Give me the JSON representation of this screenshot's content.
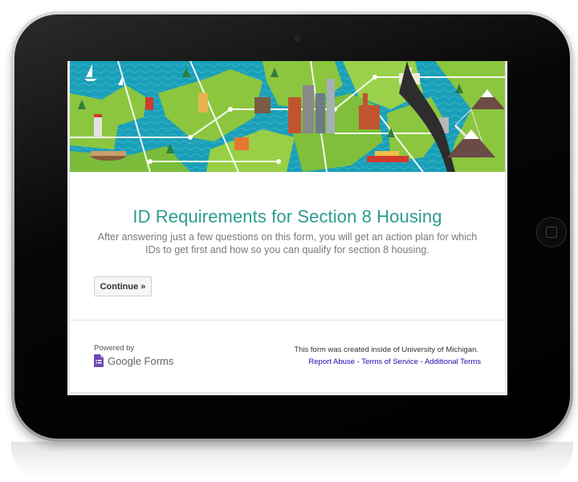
{
  "form": {
    "title": "ID Requirements for Section 8 Housing",
    "description": "After answering just a few questions on this form, you will get an action plan for which IDs to get first and how so you can qualify for section 8 housing.",
    "continue_label": "Continue »"
  },
  "footer": {
    "powered_by": "Powered by",
    "brand": "Google Forms",
    "created_inside": "This form was created inside of University of Michigan.",
    "links": {
      "report_abuse": "Report Abuse",
      "terms_of_service": "Terms of Service",
      "additional_terms": "Additional Terms",
      "separator": " - "
    }
  },
  "icons": {
    "google_forms": "google-forms-icon"
  },
  "colors": {
    "title": "#2a9d8f",
    "link": "#1a0dab",
    "banner_grass": "#8cc63f",
    "banner_water": "#1a9fb8",
    "forms_purple": "#7248b9"
  }
}
